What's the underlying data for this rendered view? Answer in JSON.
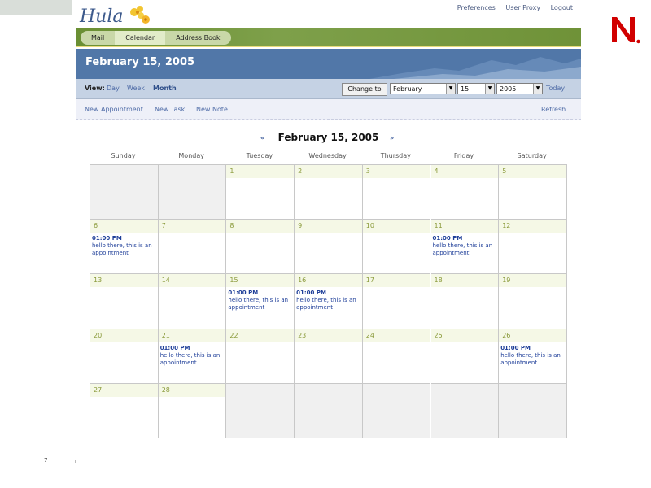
{
  "top_links": [
    "Preferences",
    "User Proxy",
    "Logout"
  ],
  "tabs": [
    "Mail",
    "Calendar",
    "Address Book"
  ],
  "title": "February 15, 2005",
  "view": {
    "label": "View:",
    "options": [
      "Day",
      "Week",
      "Month"
    ],
    "selected": "Month",
    "change_to": "Change to",
    "month": "February",
    "day": "15",
    "year": "2005",
    "today": "Today"
  },
  "actions": [
    "New Appointment",
    "New Task",
    "New Note"
  ],
  "refresh": "Refresh",
  "calendar": {
    "prev": "«",
    "next": "»",
    "heading": "February 15, 2005",
    "weekdays": [
      "Sunday",
      "Monday",
      "Tuesday",
      "Wednesday",
      "Thursday",
      "Friday",
      "Saturday"
    ],
    "weeks": [
      [
        null,
        null,
        "1",
        "2",
        "3",
        "4",
        "5"
      ],
      [
        "6",
        "7",
        "8",
        "9",
        "10",
        "11",
        "12"
      ],
      [
        "13",
        "14",
        "15",
        "16",
        "17",
        "18",
        "19"
      ],
      [
        "20",
        "21",
        "22",
        "23",
        "24",
        "25",
        "26"
      ],
      [
        "27",
        "28",
        null,
        null,
        null,
        null,
        null
      ]
    ],
    "appointments": {
      "6": {
        "time": "01:00 PM",
        "text": "hello there, this is an appointment"
      },
      "11": {
        "time": "01:00 PM",
        "text": "hello there, this is an appointment"
      },
      "15": {
        "time": "01:00 PM",
        "text": "hello there, this is an appointment"
      },
      "16": {
        "time": "01:00 PM",
        "text": "hello there, this is an appointment"
      },
      "21": {
        "time": "01:00 PM",
        "text": "hello there, this is an appointment"
      },
      "26": {
        "time": "01:00 PM",
        "text": "hello there, this is an appointment"
      }
    }
  },
  "page_number": "7",
  "logo_text": "Hula",
  "brand_logo": "N",
  "colors": {
    "tabbar": "#6e9237",
    "titlebar": "#5177a8",
    "link": "#4d6aa6",
    "novell_red": "#cc0000"
  }
}
